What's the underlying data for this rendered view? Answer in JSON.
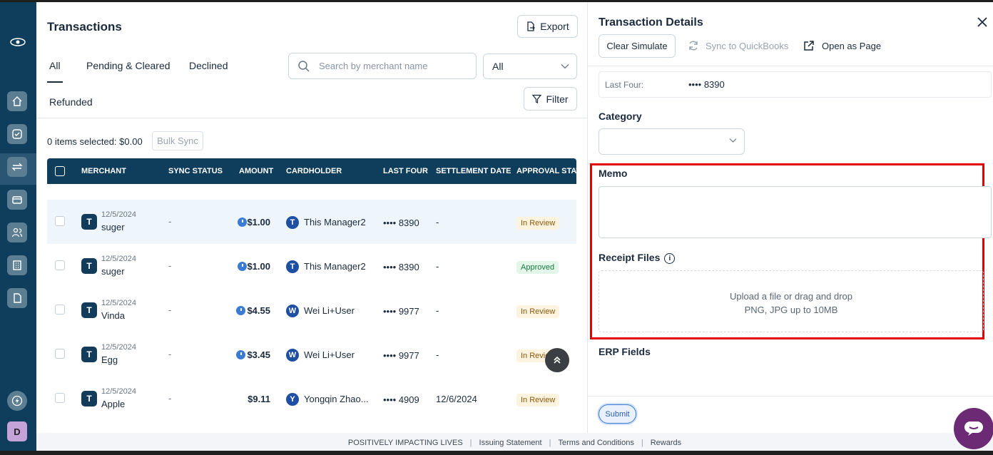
{
  "page": {
    "title": "Transactions",
    "export_label": "Export",
    "tabs": [
      "All",
      "Pending & Cleared",
      "Declined",
      "Refunded"
    ],
    "search_placeholder": "Search by merchant name",
    "status_filter": "All",
    "filter_label": "Filter",
    "selected_info": "0 items selected: $0.00",
    "bulk_sync_label": "Bulk Sync"
  },
  "table": {
    "columns": [
      "MERCHANT",
      "SYNC STATUS",
      "AMOUNT",
      "CARDHOLDER",
      "LAST FOUR",
      "SETTLEMENT DATE",
      "APPROVAL STATUS"
    ],
    "rows": [
      {
        "initial": "T",
        "date": "12/5/2024",
        "merchant": "suger",
        "sync": "-",
        "amount": "$1.00",
        "pending": true,
        "ch_initial": "T",
        "cardholder": "This Manager2",
        "last_four": "•••• 8390",
        "settlement": "-",
        "status": "In Review"
      },
      {
        "initial": "T",
        "date": "12/5/2024",
        "merchant": "suger",
        "sync": "-",
        "amount": "$1.00",
        "pending": true,
        "ch_initial": "T",
        "cardholder": "This Manager2",
        "last_four": "•••• 8390",
        "settlement": "-",
        "status": "Approved"
      },
      {
        "initial": "T",
        "date": "12/5/2024",
        "merchant": "Vinda",
        "sync": "-",
        "amount": "$4.55",
        "pending": true,
        "ch_initial": "W",
        "cardholder": "Wei Li+User",
        "last_four": "•••• 9977",
        "settlement": "-",
        "status": "In Review"
      },
      {
        "initial": "T",
        "date": "12/5/2024",
        "merchant": "Egg",
        "sync": "-",
        "amount": "$3.45",
        "pending": true,
        "ch_initial": "W",
        "cardholder": "Wei Li+User",
        "last_four": "•••• 9977",
        "settlement": "-",
        "status": "In Review"
      },
      {
        "initial": "T",
        "date": "12/5/2024",
        "merchant": "Apple",
        "sync": "-",
        "amount": "$9.11",
        "pending": false,
        "ch_initial": "Y",
        "cardholder": "Yongqin Zhao...",
        "last_four": "•••• 4909",
        "settlement": "12/6/2024",
        "status": "In Review"
      }
    ]
  },
  "details": {
    "title": "Transaction Details",
    "clear_simulate": "Clear Simulate",
    "sync_quickbooks": "Sync to QuickBooks",
    "open_as_page": "Open as Page",
    "last_four_label": "Last Four:",
    "last_four_value": "•••• 8390",
    "category_label": "Category",
    "memo_label": "Memo",
    "receipt_label": "Receipt Files",
    "upload_line1": "Upload a file or drag and drop",
    "upload_line2": "PNG, JPG up to 10MB",
    "erp_label": "ERP Fields",
    "submit_label": "Submit"
  },
  "footer": {
    "items": [
      "POSITIVELY IMPACTING LIVES",
      "Issuing Statement",
      "Terms and Conditions",
      "Rewards"
    ]
  },
  "user": {
    "avatar_initial": "D"
  },
  "colors": {
    "brand_navy": "#0f3d5c",
    "highlight_red": "#e30000",
    "in_review_bg": "#fdf3de",
    "approved_bg": "#e2f6ea"
  }
}
